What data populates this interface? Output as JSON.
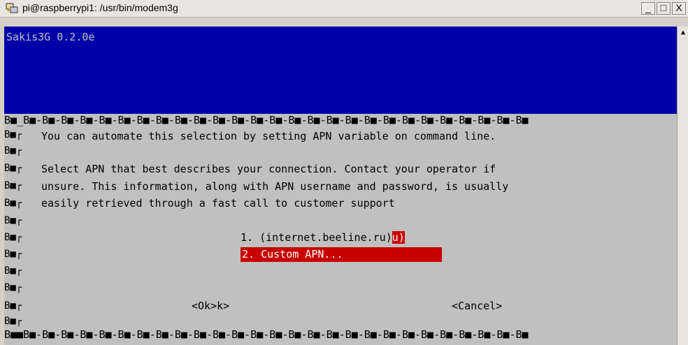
{
  "window": {
    "title": "pi@raspberrypi1: /usr/bin/modem3g",
    "minimize_label": "_",
    "maximize_label": "□",
    "close_label": "X"
  },
  "terminal": {
    "app_title": "Sakis3G 0.2.0e",
    "border_top": "B■_B■-B■-B■-B■-B■-B■-B■-B■-B■-B■-B■-B■-B■-B■-B■-B■-B■-B■-B■-B■-B■-B■-B■-B■-B■-B■-B■",
    "border_bottom": "B■■B■-B■-B■-B■-B■-B■-B■-B■-B■-B■-B■-B■-B■-B■-B■-B■-B■-B■-B■-B■-B■-B■-B■-B■-B■-B■-B■",
    "left_marker": "B■┌",
    "lines": [
      "You can automate this selection by setting APN variable on command line.",
      "",
      "Select APN that best describes your connection. Contact your operator if",
      "unsure. This information, along with APN username and password, is usually",
      "easily retrieved through a fast call to customer support"
    ],
    "menu": {
      "item1_text": "1. (internet.beeline.ru)",
      "item1_hotkey": "u)",
      "item2_text": "2. Custom APN..."
    },
    "buttons": {
      "ok": "<Ok>k>",
      "cancel": "<Cancel>"
    }
  },
  "colors": {
    "header_blue": "#0000a8",
    "terminal_gray": "#c0c0c0",
    "highlight_red": "#c80000"
  },
  "icons": {
    "title_icon": "putty-icon",
    "scroll_up": "scroll-up-arrow-icon"
  }
}
